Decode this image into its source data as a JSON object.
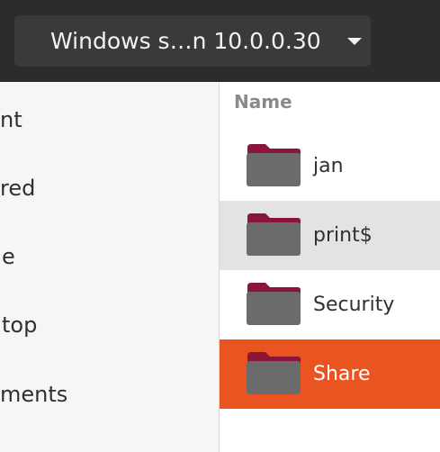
{
  "header": {
    "location_label": "Windows s…n 10.0.0.30",
    "dropdown_icon": "chevron-down-icon"
  },
  "sidebar": {
    "items": [
      {
        "label": "nt"
      },
      {
        "label": "red"
      },
      {
        "label": "e"
      },
      {
        "label": "top"
      },
      {
        "label": "ments"
      }
    ]
  },
  "list": {
    "column_header": "Name",
    "rows": [
      {
        "label": "jan",
        "icon": "folder-icon",
        "state": "normal"
      },
      {
        "label": "print$",
        "icon": "folder-icon",
        "state": "hovered"
      },
      {
        "label": "Security",
        "icon": "folder-icon",
        "state": "normal"
      },
      {
        "label": "Share",
        "icon": "folder-icon",
        "state": "selected"
      }
    ]
  },
  "colors": {
    "header_bg": "#2c2c2c",
    "location_button_bg": "#3a3a3a",
    "sidebar_bg": "#f6f6f5",
    "hover_bg": "#e3e3e3",
    "selected_bg": "#e95420",
    "folder_body": "#6b6b6b",
    "folder_tab": "#8a1538"
  }
}
